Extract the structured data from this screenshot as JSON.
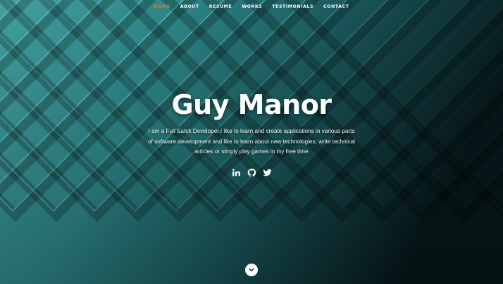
{
  "nav": {
    "items": [
      {
        "label": "HOME",
        "active": true
      },
      {
        "label": "ABOUT",
        "active": false
      },
      {
        "label": "RESUME",
        "active": false
      },
      {
        "label": "WORKS",
        "active": false
      },
      {
        "label": "TESTIMONIALS",
        "active": false
      },
      {
        "label": "CONTACT",
        "active": false
      }
    ],
    "active_color": "#e07a32"
  },
  "hero": {
    "title": "Guy Manor",
    "description": "I am a Full Satck Developer.I like to learn and create applications in various parts of software development and like to learn about new technologies, write technical articles or simply play games in my free time"
  },
  "social": [
    {
      "icon": "linkedin-icon"
    },
    {
      "icon": "github-icon"
    },
    {
      "icon": "twitter-icon"
    }
  ],
  "scroll_down": {
    "icon": "chevron-down-icon"
  },
  "colors": {
    "background_teal": "#3a9a9c",
    "background_dark": "#06171a",
    "accent_glow": "#7ff3f0"
  }
}
